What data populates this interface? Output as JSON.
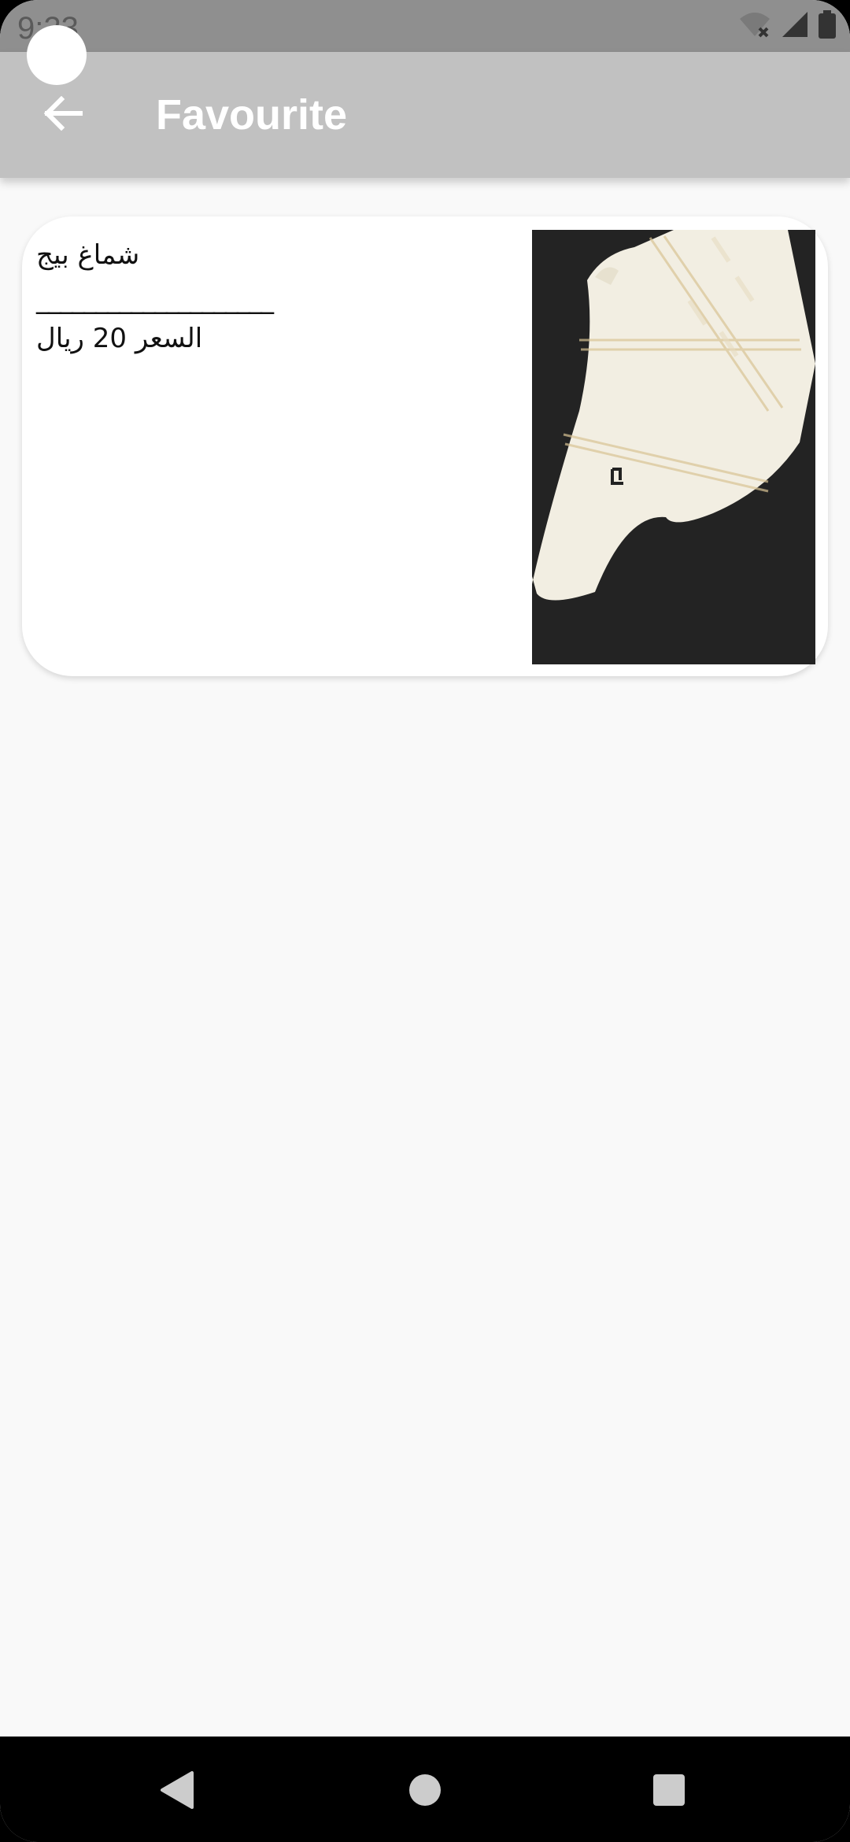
{
  "status_bar": {
    "time": "9:23",
    "icons": [
      "wifi-off-icon",
      "signal-icon",
      "battery-icon"
    ]
  },
  "app_bar": {
    "title": "Favourite",
    "back_icon": "arrow-left-icon",
    "background": "#c1c1c1"
  },
  "favourites": [
    {
      "name": "شماغ بيج",
      "divider": "____________________",
      "price": "السعر 20 ريال",
      "image": "beige-shemagh-photo"
    }
  ],
  "nav_bar": {
    "icons": [
      "back-triangle-icon",
      "home-circle-icon",
      "recents-square-icon"
    ]
  }
}
